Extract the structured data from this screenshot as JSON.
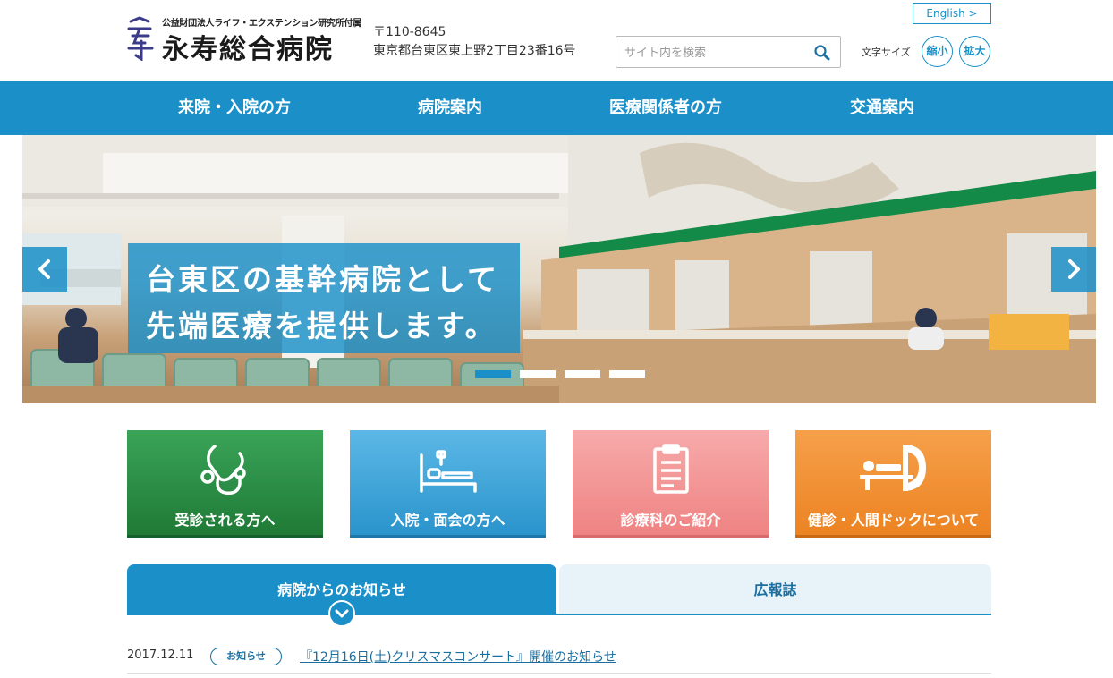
{
  "header": {
    "org_sub": "公益財団法人ライフ・エクステンション研究所付属",
    "hospital_name": "永寿総合病院",
    "postal": "〒110-8645",
    "address": "東京都台東区東上野2丁目23番16号",
    "search_placeholder": "サイト内を検索",
    "english_label": "English >",
    "font_size_label": "文字サイズ",
    "font_small": "縮小",
    "font_large": "拡大"
  },
  "nav": {
    "items": [
      "来院・入院の方",
      "病院案内",
      "医療関係者の方",
      "交通案内"
    ]
  },
  "hero": {
    "line1": "台東区の基幹病院として",
    "line2": "先端医療を提供します。",
    "slide_count": 4,
    "active_slide": 1
  },
  "tiles": [
    {
      "label": "受診される方へ",
      "icon": "stethoscope-icon",
      "color": "#2e8b45"
    },
    {
      "label": "入院・面会の方へ",
      "icon": "hospital-bed-icon",
      "color": "#2f9fd5"
    },
    {
      "label": "診療科のご紹介",
      "icon": "clipboard-icon",
      "color": "#f07f7f"
    },
    {
      "label": "健診・人間ドックについて",
      "icon": "mri-scanner-icon",
      "color": "#f08a24"
    }
  ],
  "tabs": {
    "active": "病院からのお知らせ",
    "inactive": "広報誌"
  },
  "news": [
    {
      "date": "2017.12.11",
      "badge": "お知らせ",
      "title": "『12月16日(土)クリスマスコンサート』開催のお知らせ"
    }
  ],
  "colors": {
    "brand_blue": "#1a8fc8",
    "link_blue": "#1a6fa0"
  }
}
